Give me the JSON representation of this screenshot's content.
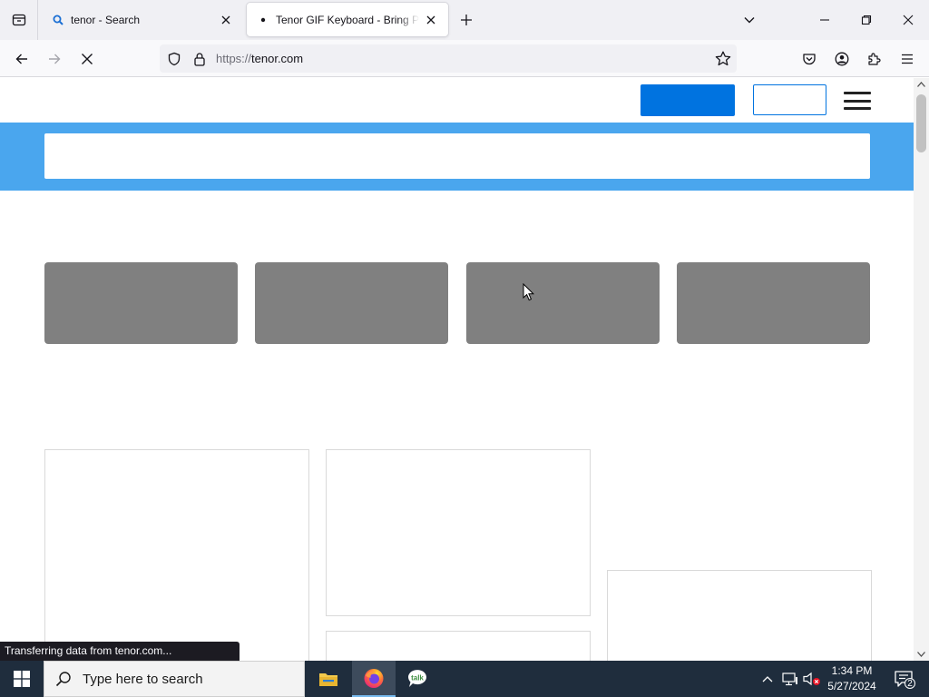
{
  "browser": {
    "tabs": [
      {
        "title": "tenor - Search",
        "favicon": "search-icon",
        "active": false
      },
      {
        "title": "Tenor GIF Keyboard - Bring Personality To Your Conversations",
        "favicon": "dot-icon",
        "active": true
      }
    ],
    "url": {
      "protocol": "https://",
      "host": "tenor.com"
    },
    "status_text": "Transferring data from tenor.com..."
  },
  "page": {
    "colors": {
      "primary": "#0073e0",
      "search_band": "#4aa6ee",
      "tile": "#808080"
    }
  },
  "taskbar": {
    "search_placeholder": "Type here to search",
    "time": "1:34 PM",
    "date": "5/27/2024",
    "notification_count": "2"
  }
}
